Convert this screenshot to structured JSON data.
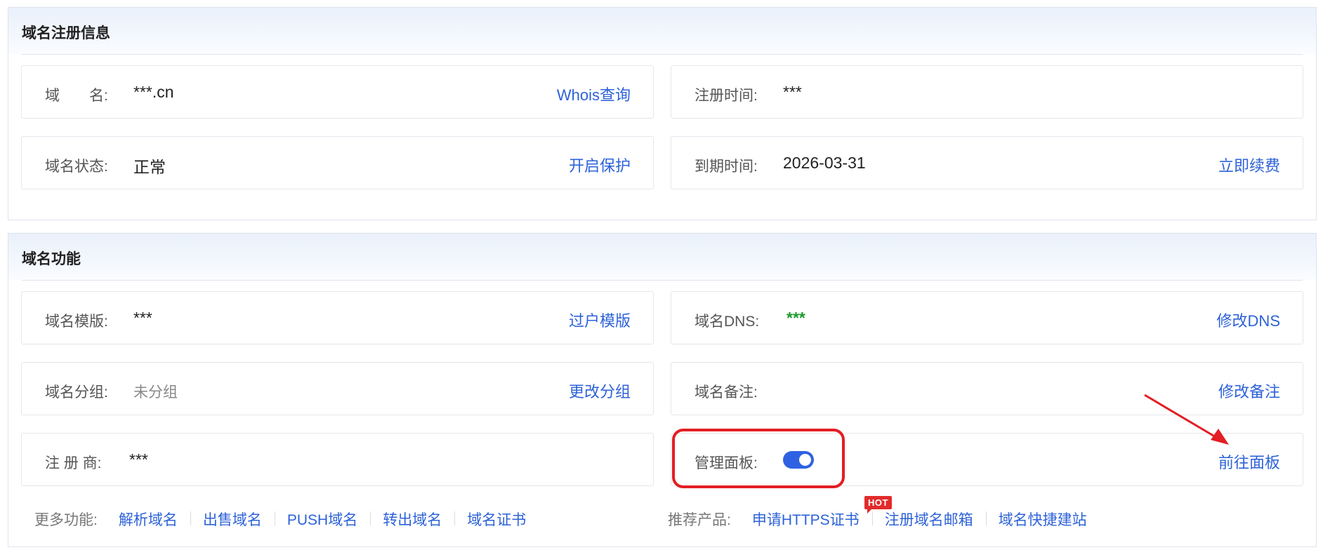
{
  "section_registration": {
    "title": "域名注册信息",
    "domain_name": {
      "label": "域　　名:",
      "value": "***.cn",
      "action": "Whois查询"
    },
    "reg_time": {
      "label": "注册时间:",
      "value": "***"
    },
    "status": {
      "label": "域名状态:",
      "value": "正常",
      "action": "开启保护"
    },
    "expire": {
      "label": "到期时间:",
      "value": "2026-03-31",
      "action": "立即续费"
    }
  },
  "section_features": {
    "title": "域名功能",
    "template": {
      "label": "域名模版:",
      "value": "***",
      "action": "过户模版"
    },
    "dns": {
      "label": "域名DNS:",
      "value": "***",
      "action": "修改DNS"
    },
    "group": {
      "label": "域名分组:",
      "value": "未分组",
      "action": "更改分组"
    },
    "remark": {
      "label": "域名备注:",
      "value": "",
      "action": "修改备注"
    },
    "registrar": {
      "label": "注 册 商:",
      "value": "***"
    },
    "panel": {
      "label": "管理面板:",
      "toggle_on": true,
      "action": "前往面板"
    }
  },
  "more": {
    "label": "更多功能:",
    "links": [
      "解析域名",
      "出售域名",
      "PUSH域名",
      "转出域名",
      "域名证书"
    ]
  },
  "recommend": {
    "label": "推荐产品:",
    "links": [
      "申请HTTPS证书",
      "注册域名邮箱",
      "域名快捷建站"
    ],
    "badge": "HOT"
  },
  "colors": {
    "link": "#2d62d8",
    "toggle": "#2f62e3",
    "highlight": "#e31e24",
    "dns_value": "#1b9a2e"
  }
}
